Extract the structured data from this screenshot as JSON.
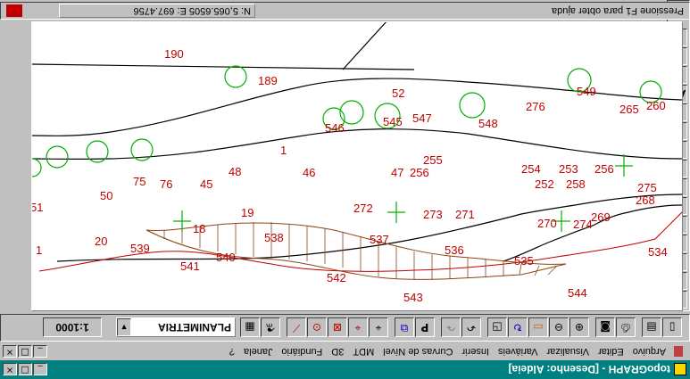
{
  "window": {
    "title": "topoGRAPH - [Desenho: Aldeia]",
    "controls": [
      "_",
      "□",
      "×"
    ]
  },
  "menu": [
    "Arquivo",
    "Editar",
    "Visualizar",
    "Variáveis",
    "Inserir",
    "Curvas de Nível",
    "MDT",
    "3D",
    "Fundiário",
    "Janela",
    "?"
  ],
  "doc_controls": [
    "_",
    "□",
    "×"
  ],
  "toolbar": {
    "icons": [
      "new-icon",
      "save-icon",
      "print-icon",
      "preview-icon",
      "zoom-in-icon",
      "zoom-out-icon",
      "zoom-window-icon",
      "redraw-icon",
      "select-icon",
      "undo-icon",
      "redo-icon",
      "bold-p-icon",
      "copy-icon",
      "snap-center-icon",
      "snap-node-icon",
      "snap-intersection-icon",
      "snap-point-icon",
      "line-icon",
      "measure-icon",
      "grid-icon"
    ],
    "layer_value": "PLANIMETRIA",
    "scale": "1:1000"
  },
  "status": {
    "help": "Pressione F1 para obter ajuda",
    "coords": "N: 5,065.6505 E: 697.4756"
  },
  "sidepanel": [
    "+",
    "/",
    "N",
    "Z",
    "~",
    "(",
    ")",
    "C",
    "O",
    "O",
    "O",
    "Ab",
    "⊕",
    "□",
    "▣"
  ],
  "drawing": {
    "labels": [
      "190",
      "189",
      "52",
      "549",
      "546",
      "545",
      "547",
      "548",
      "276",
      "265",
      "260",
      "1",
      "254",
      "253",
      "256",
      "252",
      "258",
      "255",
      "47",
      "256",
      "46",
      "45",
      "48",
      "51",
      "50",
      "75",
      "76",
      "61",
      "275",
      "268",
      "272",
      "271",
      "273",
      "19",
      "270",
      "274",
      "269",
      "18",
      "20",
      "1",
      "539",
      "538",
      "537",
      "536",
      "534",
      "541",
      "540",
      "535",
      "542",
      "543",
      "544"
    ]
  }
}
